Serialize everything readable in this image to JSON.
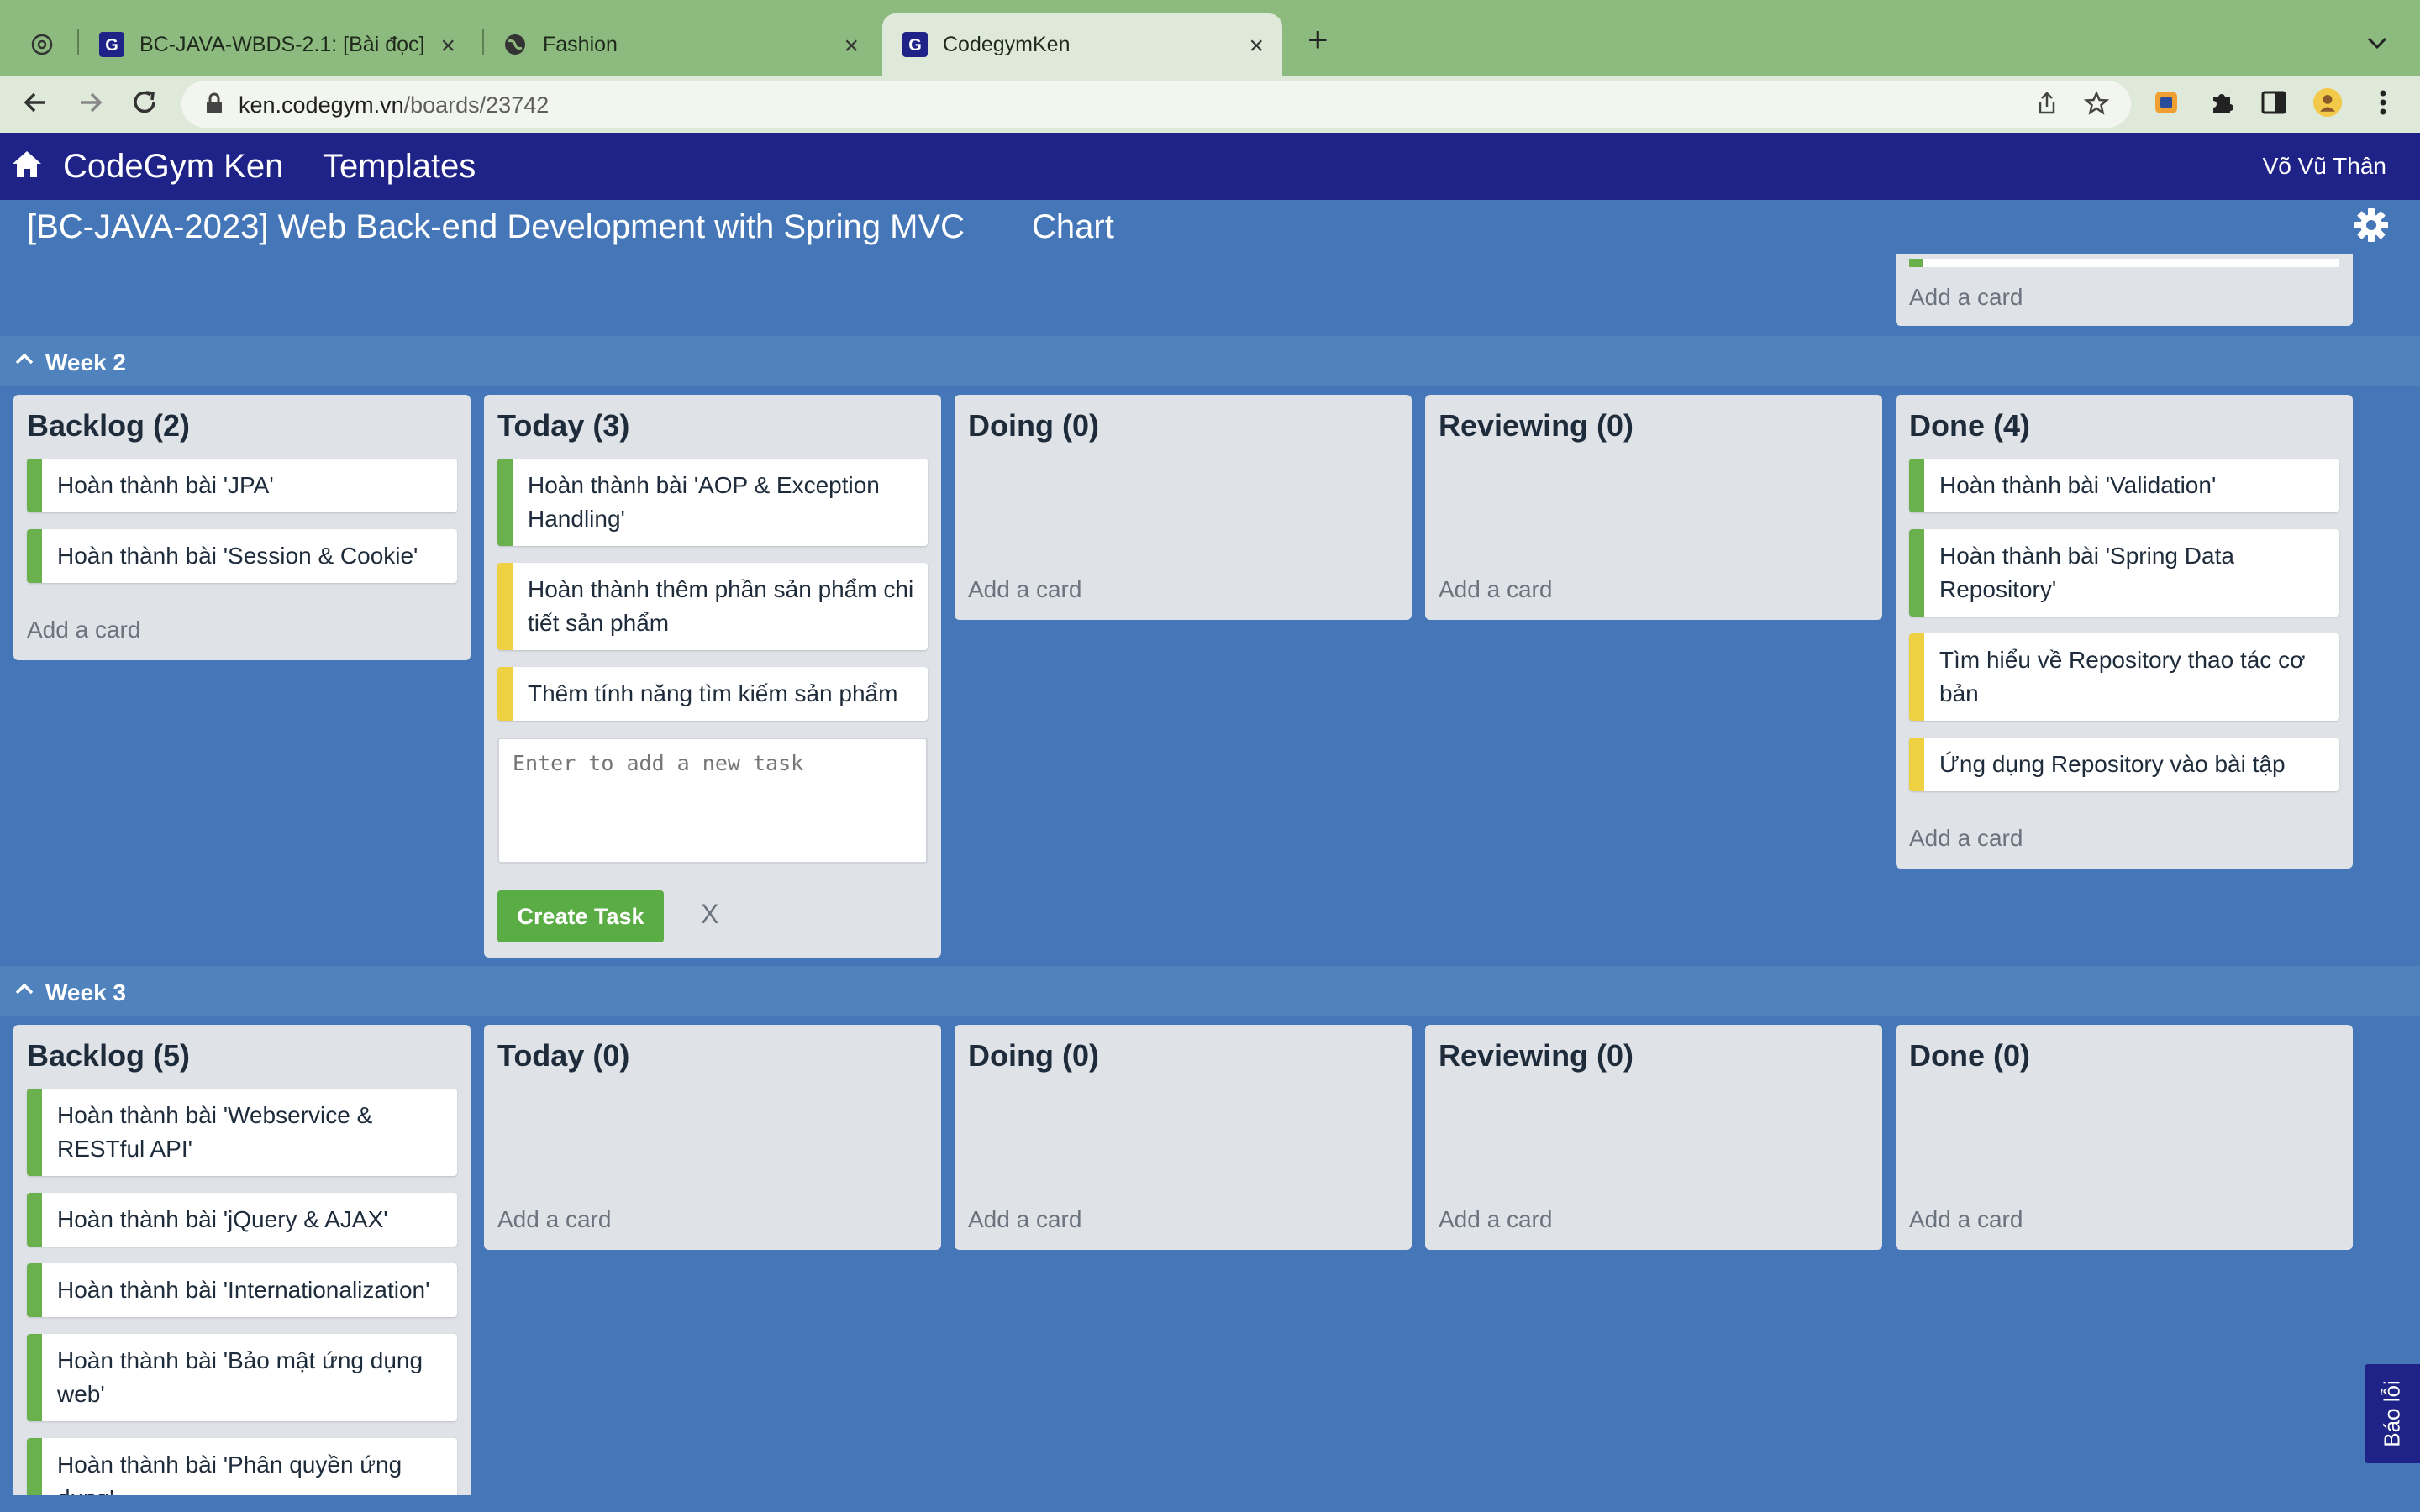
{
  "browser": {
    "tabs": [
      {
        "title": ""
      },
      {
        "title": "BC-JAVA-WBDS-2.1: [Bài đọc]"
      },
      {
        "title": "Fashion"
      },
      {
        "title": "CodegymKen"
      }
    ],
    "url_host": "ken.codegym.vn",
    "url_path": "/boards/23742"
  },
  "header": {
    "brand": "CodeGym Ken",
    "templates": "Templates",
    "user": "Võ Vũ Thân"
  },
  "board": {
    "title": "[BC-JAVA-2023] Web Back-end Development with Spring MVC",
    "chart_link": "Chart"
  },
  "add_card_label": "Add a card",
  "weeks": [
    {
      "title": "Week 2",
      "lists": [
        {
          "title": "Backlog (2)",
          "cards": [
            "Hoàn thành bài 'JPA'",
            "Hoàn thành bài 'Session & Cookie'"
          ]
        },
        {
          "title": "Today (3)",
          "cards": [
            "Hoàn thành bài 'AOP & Exception Handling'",
            "Hoàn thành thêm phần sản phẩm chi tiết sản phẩm",
            "Thêm tính năng tìm kiếm sản phẩm"
          ]
        },
        {
          "title": "Doing (0)",
          "cards": []
        },
        {
          "title": "Reviewing (0)",
          "cards": []
        },
        {
          "title": "Done (4)",
          "cards": [
            "Hoàn thành bài 'Validation'",
            "Hoàn thành bài 'Spring Data Repository'",
            "Tìm hiểu về Repository thao tác cơ bản",
            "Ứng dụng Repository vào bài tập"
          ]
        }
      ]
    },
    {
      "title": "Week 3",
      "lists": [
        {
          "title": "Backlog (5)",
          "cards": [
            "Hoàn thành bài 'Webservice & RESTful API'",
            "Hoàn thành bài 'jQuery & AJAX'",
            "Hoàn thành bài 'Internationalization'",
            "Hoàn thành bài 'Bảo mật ứng dụng web'",
            "Hoàn thành bài 'Phân quyền ứng dụng'"
          ]
        },
        {
          "title": "Today (0)",
          "cards": []
        },
        {
          "title": "Doing (0)",
          "cards": []
        },
        {
          "title": "Reviewing (0)",
          "cards": []
        },
        {
          "title": "Done (0)",
          "cards": []
        }
      ]
    }
  ],
  "new_task": {
    "placeholder": "Enter to add a new task",
    "create_label": "Create Task",
    "cancel_label": "X"
  },
  "bug_report": "Báo lỗi",
  "colors": {
    "nav": "#1f2387",
    "board_bg": "#4577b8",
    "card_green": "#6ab04c",
    "card_yellow": "#eed142",
    "create_button": "#5aac44"
  }
}
